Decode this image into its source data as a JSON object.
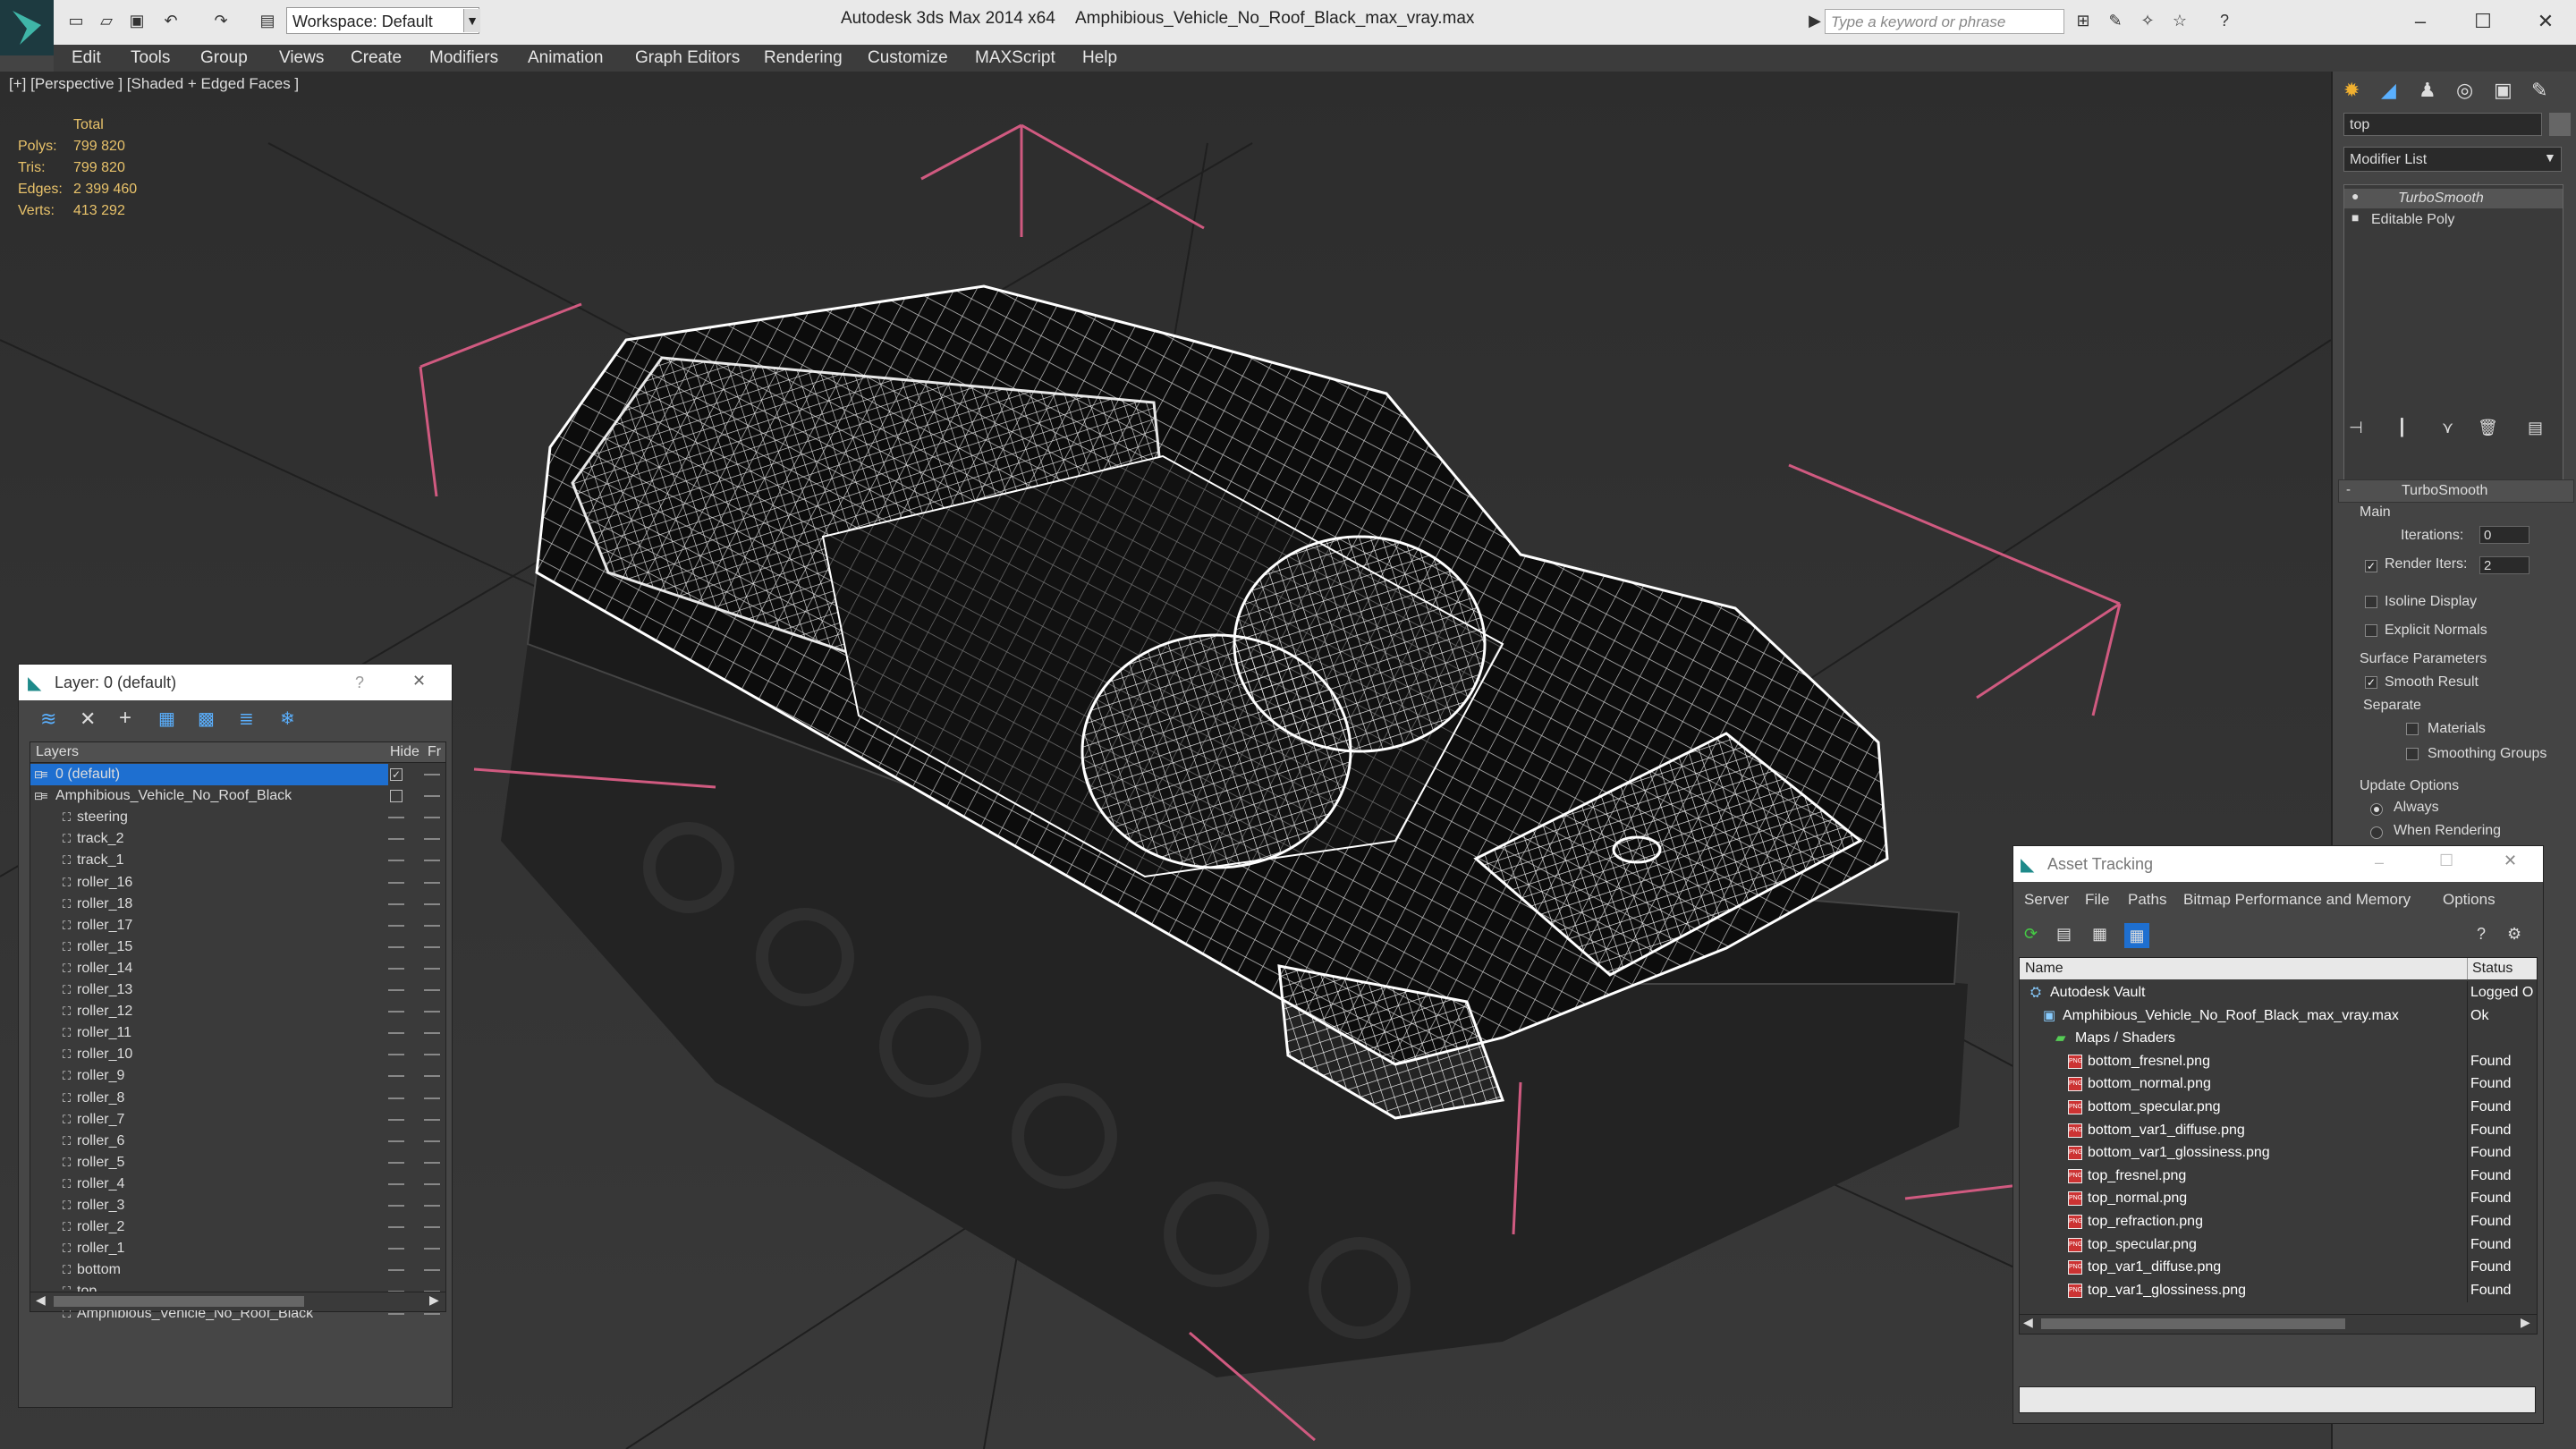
{
  "titlebar": {
    "app_title": "Autodesk 3ds Max  2014 x64",
    "file_name": "Amphibious_Vehicle_No_Roof_Black_max_vray.max",
    "workspace": "Workspace: Default",
    "search_placeholder": "Type a keyword or phrase"
  },
  "menu": [
    "Edit",
    "Tools",
    "Group",
    "Views",
    "Create",
    "Modifiers",
    "Animation",
    "Graph Editors",
    "Rendering",
    "Customize",
    "MAXScript",
    "Help"
  ],
  "viewport": {
    "label": "[+] [Perspective ] [Shaded + Edged Faces ]",
    "stats": {
      "header": "Total",
      "rows": [
        {
          "label": "Polys:",
          "value": "799 820"
        },
        {
          "label": "Tris:",
          "value": "799 820"
        },
        {
          "label": "Edges:",
          "value": "2 399 460"
        },
        {
          "label": "Verts:",
          "value": "413 292"
        }
      ]
    }
  },
  "command_panel": {
    "object_name": "top",
    "modifier_list": "Modifier List",
    "stack": [
      "TurboSmooth",
      "Editable Poly"
    ],
    "rollout": "TurboSmooth",
    "main": "Main",
    "iterations_label": "Iterations:",
    "iterations": "0",
    "render_iters_label": "Render Iters:",
    "render_iters": "2",
    "isoline": "Isoline Display",
    "explicit_normals": "Explicit Normals",
    "surface_params": "Surface Parameters",
    "smooth_result": "Smooth Result",
    "separate": "Separate",
    "materials": "Materials",
    "smoothing_groups": "Smoothing Groups",
    "update_options": "Update Options",
    "always": "Always",
    "when_rendering": "When Rendering"
  },
  "layer_dialog": {
    "title": "Layer: 0 (default)",
    "help": "?",
    "col_layers": "Layers",
    "col_hide": "Hide",
    "col_fr": "Fr",
    "rows": [
      {
        "name": "0 (default)",
        "indent": 0,
        "selected": true
      },
      {
        "name": "Amphibious_Vehicle_No_Roof_Black",
        "indent": 0,
        "selected": false
      },
      {
        "name": "steering",
        "indent": 1
      },
      {
        "name": "track_2",
        "indent": 1
      },
      {
        "name": "track_1",
        "indent": 1
      },
      {
        "name": "roller_16",
        "indent": 1
      },
      {
        "name": "roller_18",
        "indent": 1
      },
      {
        "name": "roller_17",
        "indent": 1
      },
      {
        "name": "roller_15",
        "indent": 1
      },
      {
        "name": "roller_14",
        "indent": 1
      },
      {
        "name": "roller_13",
        "indent": 1
      },
      {
        "name": "roller_12",
        "indent": 1
      },
      {
        "name": "roller_11",
        "indent": 1
      },
      {
        "name": "roller_10",
        "indent": 1
      },
      {
        "name": "roller_9",
        "indent": 1
      },
      {
        "name": "roller_8",
        "indent": 1
      },
      {
        "name": "roller_7",
        "indent": 1
      },
      {
        "name": "roller_6",
        "indent": 1
      },
      {
        "name": "roller_5",
        "indent": 1
      },
      {
        "name": "roller_4",
        "indent": 1
      },
      {
        "name": "roller_3",
        "indent": 1
      },
      {
        "name": "roller_2",
        "indent": 1
      },
      {
        "name": "roller_1",
        "indent": 1
      },
      {
        "name": "bottom",
        "indent": 1
      },
      {
        "name": "top",
        "indent": 1
      },
      {
        "name": "Amphibious_Vehicle_No_Roof_Black",
        "indent": 1
      }
    ]
  },
  "asset_tracking": {
    "title": "Asset Tracking",
    "menu": [
      "Server",
      "File",
      "Paths",
      "Bitmap Performance and Memory",
      "Options"
    ],
    "col_name": "Name",
    "col_status": "Status",
    "rows": [
      {
        "name": "Autodesk Vault",
        "status": "Logged O",
        "level": 0,
        "kind": "vault"
      },
      {
        "name": "Amphibious_Vehicle_No_Roof_Black_max_vray.max",
        "status": "Ok",
        "level": 1,
        "kind": "max"
      },
      {
        "name": "Maps / Shaders",
        "status": "",
        "level": 2,
        "kind": "folder"
      },
      {
        "name": "bottom_fresnel.png",
        "status": "Found",
        "level": 3,
        "kind": "png"
      },
      {
        "name": "bottom_normal.png",
        "status": "Found",
        "level": 3,
        "kind": "png"
      },
      {
        "name": "bottom_specular.png",
        "status": "Found",
        "level": 3,
        "kind": "png"
      },
      {
        "name": "bottom_var1_diffuse.png",
        "status": "Found",
        "level": 3,
        "kind": "png"
      },
      {
        "name": "bottom_var1_glossiness.png",
        "status": "Found",
        "level": 3,
        "kind": "png"
      },
      {
        "name": "top_fresnel.png",
        "status": "Found",
        "level": 3,
        "kind": "png"
      },
      {
        "name": "top_normal.png",
        "status": "Found",
        "level": 3,
        "kind": "png"
      },
      {
        "name": "top_refraction.png",
        "status": "Found",
        "level": 3,
        "kind": "png"
      },
      {
        "name": "top_specular.png",
        "status": "Found",
        "level": 3,
        "kind": "png"
      },
      {
        "name": "top_var1_diffuse.png",
        "status": "Found",
        "level": 3,
        "kind": "png"
      },
      {
        "name": "top_var1_glossiness.png",
        "status": "Found",
        "level": 3,
        "kind": "png"
      }
    ]
  },
  "colors": {
    "accent_blue": "#1e6fd0",
    "stat_yellow": "#e8c26a",
    "bbox_pink": "#d05a80"
  }
}
